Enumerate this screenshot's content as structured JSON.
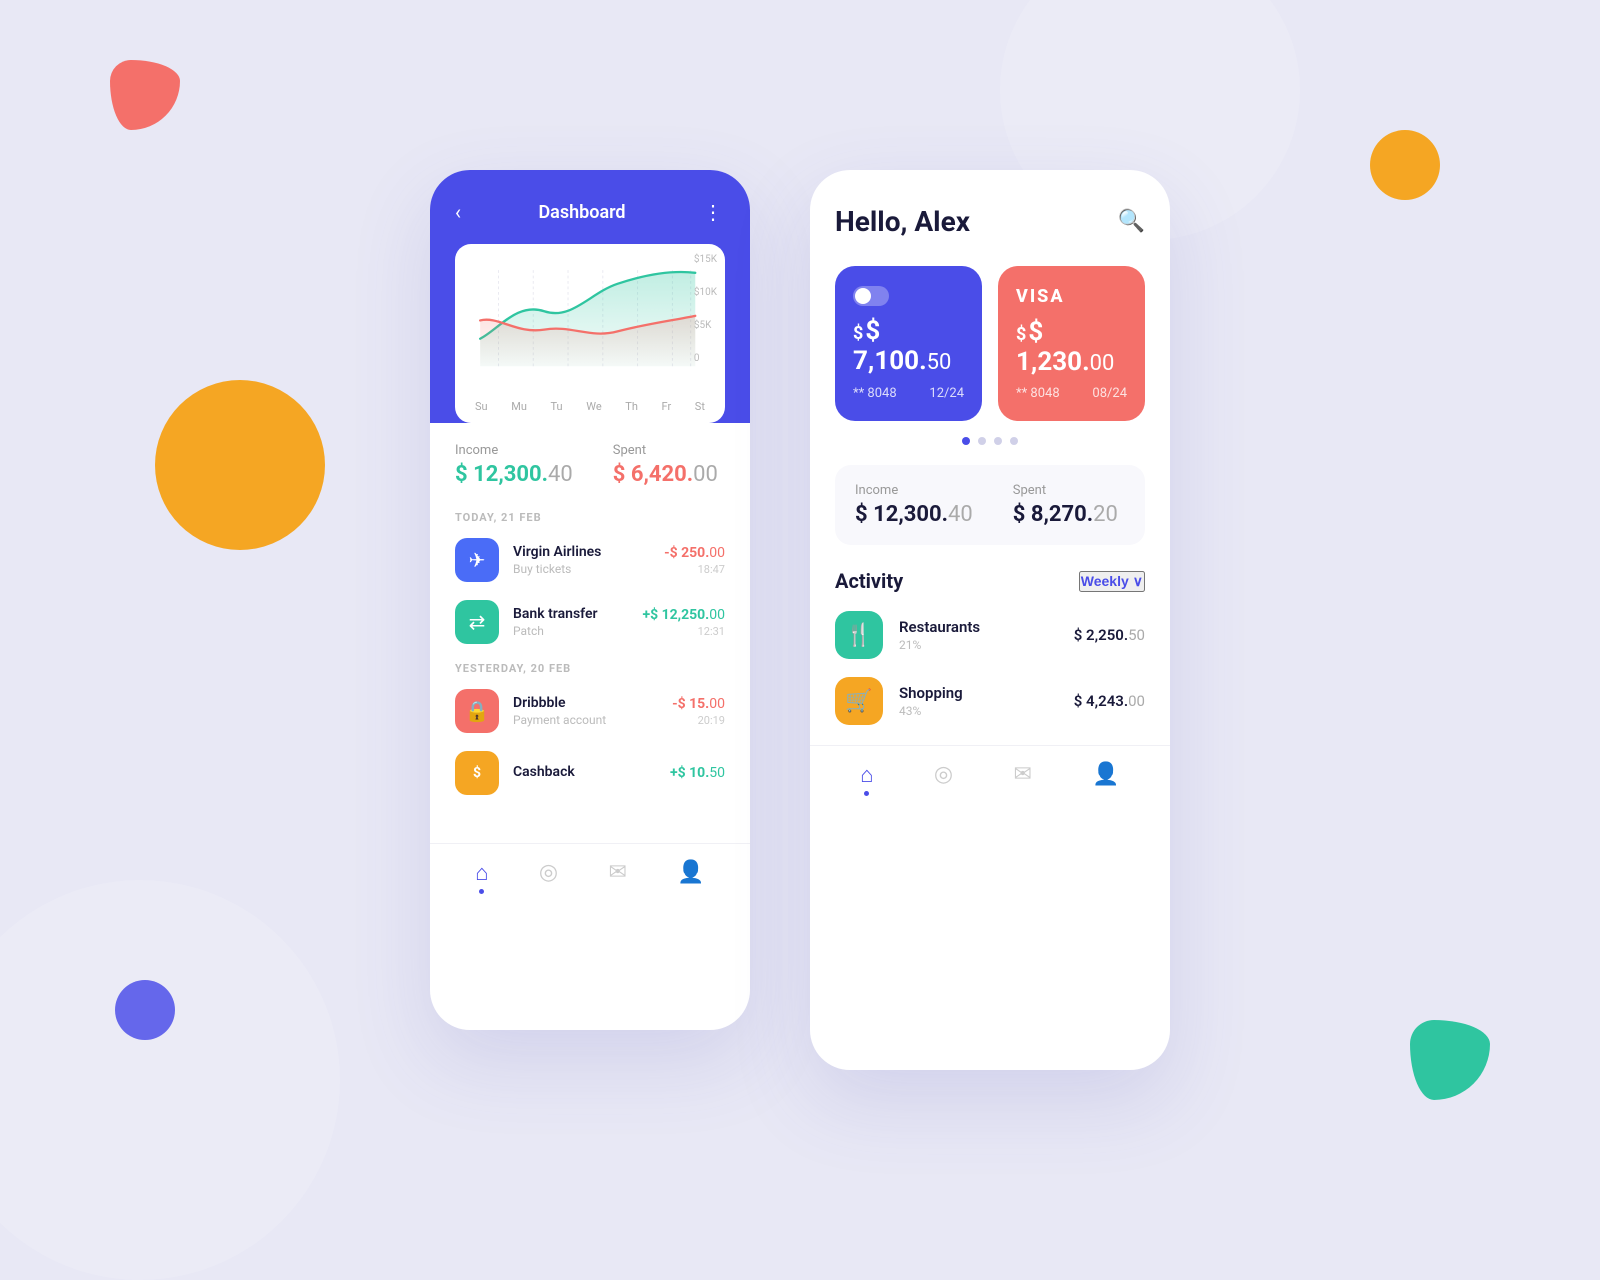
{
  "background": "#e8e8f5",
  "blobs": {
    "red": {
      "color": "#f4706a"
    },
    "orange": {
      "color": "#f5a623"
    },
    "blue": {
      "color": "#4a4de8"
    },
    "teal": {
      "color": "#2fc5a0"
    }
  },
  "left_phone": {
    "header": {
      "back_label": "‹",
      "title": "Dashboard",
      "more_label": "⋮"
    },
    "chart": {
      "y_labels": [
        "$15K",
        "$10K",
        "$5K",
        "0"
      ],
      "x_labels": [
        "Su",
        "Mu",
        "Tu",
        "We",
        "Th",
        "Fr",
        "St"
      ]
    },
    "income": {
      "label": "Income",
      "value": "$ 12,300.",
      "cents": "40"
    },
    "spent": {
      "label": "Spent",
      "value": "$ 6,420.",
      "cents": "00"
    },
    "today_label": "TODAY, 21 FEB",
    "transactions_today": [
      {
        "icon": "✈",
        "icon_class": "tx-icon-blue",
        "name": "Virgin Airlines",
        "sub": "Buy tickets",
        "amount": "-$ 250.",
        "cents": "00",
        "time": "18:47",
        "type": "neg"
      },
      {
        "icon": "⇄",
        "icon_class": "tx-icon-teal",
        "name": "Bank transfer",
        "sub": "Patch",
        "amount": "+$ 12,250.",
        "cents": "00",
        "time": "12:31",
        "type": "pos"
      }
    ],
    "yesterday_label": "YESTERDAY, 20 FEB",
    "transactions_yesterday": [
      {
        "icon": "🔒",
        "icon_class": "tx-icon-red",
        "name": "Dribbble",
        "sub": "Payment account",
        "amount": "-$ 15.",
        "cents": "00",
        "time": "20:19",
        "type": "neg"
      },
      {
        "icon": "₵",
        "icon_class": "tx-icon-orange",
        "name": "Cashback",
        "sub": "",
        "amount": "+$ 10.",
        "cents": "50",
        "time": "",
        "type": "pos"
      }
    ],
    "bottom_nav": [
      {
        "icon": "⌂",
        "label": "home",
        "active": true
      },
      {
        "icon": "◎",
        "label": "globe",
        "active": false
      },
      {
        "icon": "✉",
        "label": "chat",
        "active": false
      },
      {
        "icon": "👤",
        "label": "profile",
        "active": false
      }
    ]
  },
  "right_phone": {
    "greeting": "Hello, Alex",
    "search_icon": "🔍",
    "card_blue": {
      "amount": "$ 7,100.",
      "cents": "50",
      "card_number": "** 8048",
      "expiry": "12/24"
    },
    "card_red": {
      "brand": "VISA",
      "amount": "$ 1,230.",
      "cents": "00",
      "card_number": "** 8048",
      "expiry": "08/24"
    },
    "dots": [
      true,
      false,
      false,
      false
    ],
    "income": {
      "label": "Income",
      "value": "$ 12,300.",
      "cents": "40"
    },
    "spent": {
      "label": "Spent",
      "value": "$ 8,270.",
      "cents": "20"
    },
    "activity_title": "Activity",
    "weekly_label": "Weekly",
    "activities": [
      {
        "icon": "🍴",
        "icon_class": "activity-icon-teal",
        "name": "Restaurants",
        "pct": "21%",
        "amount": "$ 2,250.",
        "cents": "50"
      },
      {
        "icon": "🛒",
        "icon_class": "activity-icon-orange",
        "name": "Shopping",
        "pct": "43%",
        "amount": "$ 4,243.",
        "cents": "00"
      }
    ],
    "bottom_nav": [
      {
        "icon": "⌂",
        "label": "home",
        "active": true
      },
      {
        "icon": "◎",
        "label": "globe",
        "active": false
      },
      {
        "icon": "✉",
        "label": "chat",
        "active": false
      },
      {
        "icon": "👤",
        "label": "profile",
        "active": false
      }
    ]
  }
}
